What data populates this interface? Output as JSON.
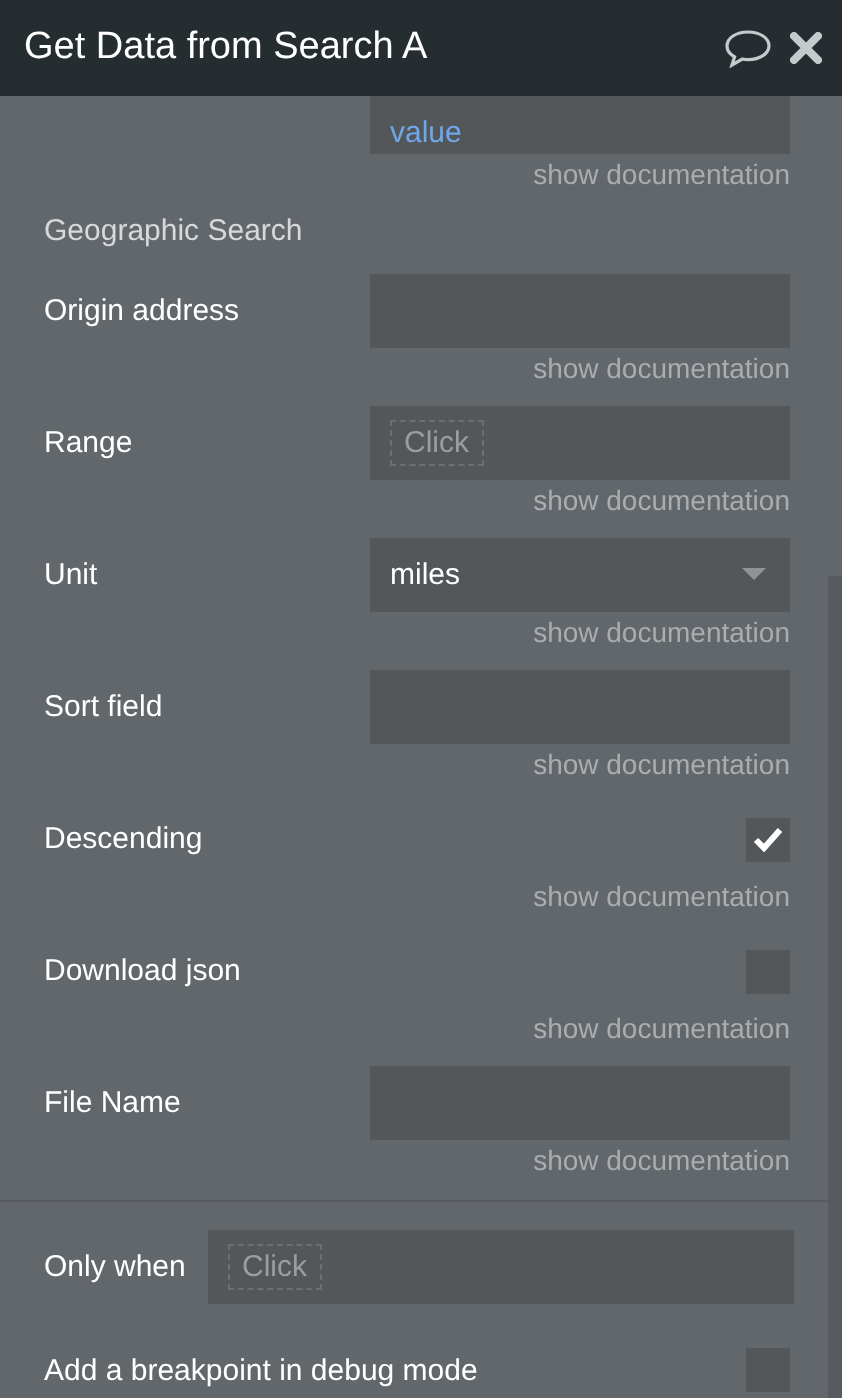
{
  "header": {
    "title": "Get Data from Search A"
  },
  "top_field": {
    "value": "value",
    "doc": "show documentation"
  },
  "section": "Geographic Search",
  "fields": [
    {
      "label": "Origin address",
      "kind": "text",
      "doc": "show documentation"
    },
    {
      "label": "Range",
      "kind": "click",
      "placeholder": "Click",
      "doc": "show documentation"
    },
    {
      "label": "Unit",
      "kind": "dropdown",
      "value": "miles",
      "doc": "show documentation"
    },
    {
      "label": "Sort field",
      "kind": "text",
      "doc": "show documentation"
    },
    {
      "label": "Descending",
      "kind": "checkbox",
      "checked": true,
      "doc": "show documentation"
    },
    {
      "label": "Download json",
      "kind": "checkbox",
      "checked": false,
      "doc": "show documentation"
    },
    {
      "label": "File Name",
      "kind": "text",
      "doc": "show documentation"
    }
  ],
  "only_when": {
    "label": "Only when",
    "placeholder": "Click"
  },
  "breakpoint": {
    "label": "Add a breakpoint in debug mode",
    "checked": false
  }
}
